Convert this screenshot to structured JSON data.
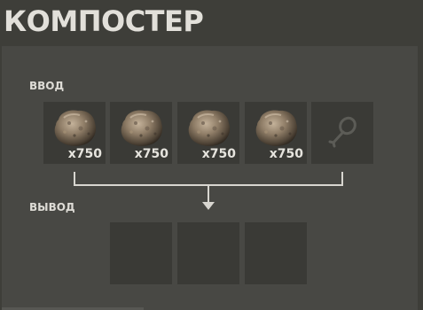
{
  "window": {
    "title": "КОМПОСТЕР"
  },
  "input": {
    "label": "ВВОД",
    "slots": [
      {
        "item": "stone-icon",
        "quantity": "x750"
      },
      {
        "item": "stone-icon",
        "quantity": "x750"
      },
      {
        "item": "stone-icon",
        "quantity": "x750"
      },
      {
        "item": "stone-icon",
        "quantity": "x750"
      },
      {
        "item": "drumstick-icon",
        "quantity": ""
      }
    ]
  },
  "output": {
    "label": "ВЫВОД",
    "slots": [
      {
        "item": "",
        "quantity": ""
      },
      {
        "item": "",
        "quantity": ""
      },
      {
        "item": "",
        "quantity": ""
      }
    ]
  },
  "colors": {
    "background": "#3e3e39",
    "panel": "#484844",
    "slot": "#3a3a36",
    "text": "#e2e0da",
    "connector": "#d8d6d0"
  }
}
